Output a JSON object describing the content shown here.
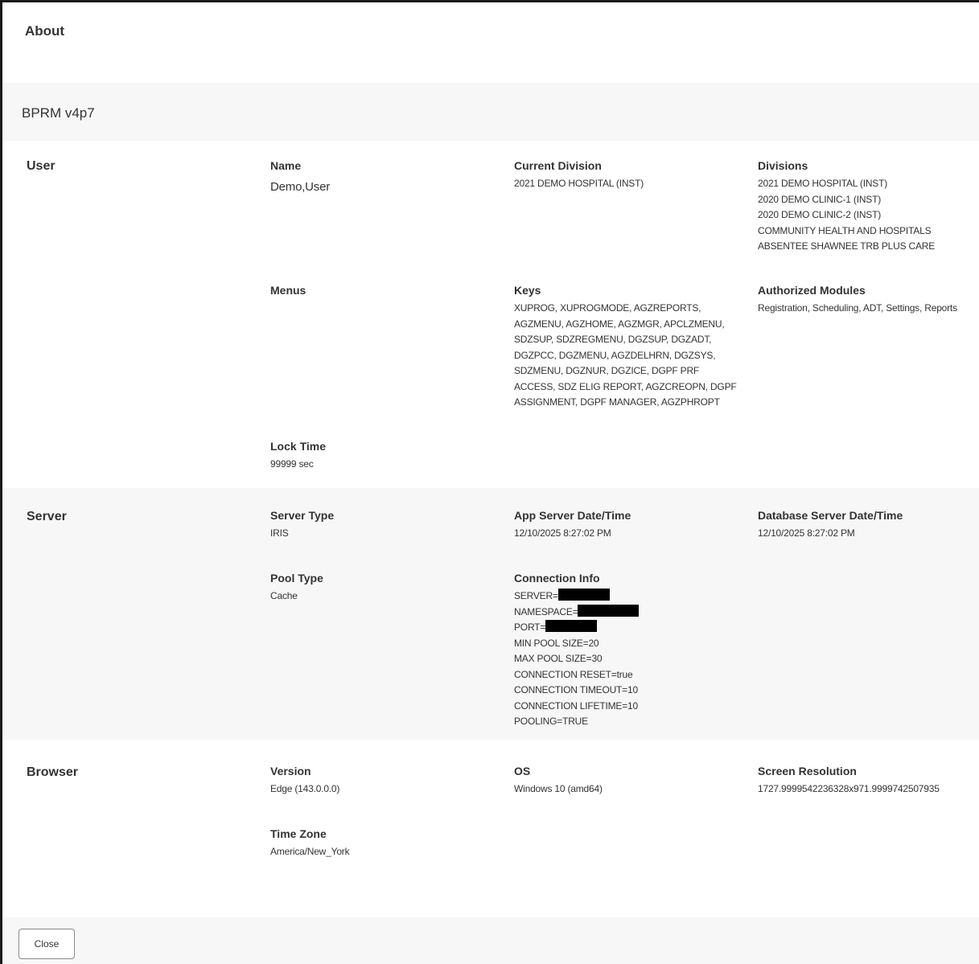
{
  "dialog": {
    "title": "About",
    "app_name": "BPRM v4p7"
  },
  "user": {
    "section_label": "User",
    "name_label": "Name",
    "name_value": "Demo,User",
    "current_division_label": "Current Division",
    "current_division_value": "2021 DEMO HOSPITAL (INST)",
    "divisions_label": "Divisions",
    "divisions": [
      "2021 DEMO HOSPITAL (INST)",
      "2020 DEMO CLINIC-1 (INST)",
      "2020 DEMO CLINIC-2 (INST)",
      "COMMUNITY HEALTH AND HOSPITALS",
      "ABSENTEE SHAWNEE TRB PLUS CARE"
    ],
    "menus_label": "Menus",
    "keys_label": "Keys",
    "keys_lines": [
      "XUPROG, XUPROGMODE, AGZREPORTS,",
      "AGZMENU, AGZHOME, AGZMGR, APCLZMENU,",
      "SDZSUP, SDZREGMENU, DGZSUP, DGZADT,",
      "DGZPCC, DGZMENU, AGZDELHRN, DGZSYS,",
      "SDZMENU, DGZNUR, DGZICE, DGPF PRF",
      "ACCESS, SDZ ELIG REPORT, AGZCREOPN, DGPF",
      "ASSIGNMENT, DGPF MANAGER, AGZPHROPT"
    ],
    "authorized_modules_label": "Authorized Modules",
    "authorized_modules_value": "Registration, Scheduling, ADT, Settings, Reports",
    "lock_time_label": "Lock Time",
    "lock_time_value": "99999 sec"
  },
  "server": {
    "section_label": "Server",
    "server_type_label": "Server Type",
    "server_type_value": "IRIS",
    "app_server_datetime_label": "App Server Date/Time",
    "app_server_datetime_value": "12/10/2025 8:27:02 PM",
    "db_server_datetime_label": "Database Server Date/Time",
    "db_server_datetime_value": "12/10/2025 8:27:02 PM",
    "pool_type_label": "Pool Type",
    "pool_type_value": "Cache",
    "connection_info_label": "Connection Info",
    "connection_info": {
      "server_prefix": "SERVER=",
      "namespace_prefix": "NAMESPACE=",
      "port_prefix": "PORT=",
      "lines": [
        "MIN POOL SIZE=20",
        "MAX POOL SIZE=30",
        "CONNECTION RESET=true",
        "CONNECTION TIMEOUT=10",
        "CONNECTION LIFETIME=10",
        "POOLING=TRUE"
      ]
    }
  },
  "browser": {
    "section_label": "Browser",
    "version_label": "Version",
    "version_value": "Edge (143.0.0.0)",
    "os_label": "OS",
    "os_value": "Windows 10 (amd64)",
    "screen_resolution_label": "Screen Resolution",
    "screen_resolution_value": "1727.9999542236328x971.9999742507935",
    "time_zone_label": "Time Zone",
    "time_zone_value": "America/New_York"
  },
  "footer": {
    "close_label": "Close"
  },
  "colors": {
    "band_background": "#f7f7f7",
    "border": "#1a1a1a",
    "text": "#333333"
  }
}
